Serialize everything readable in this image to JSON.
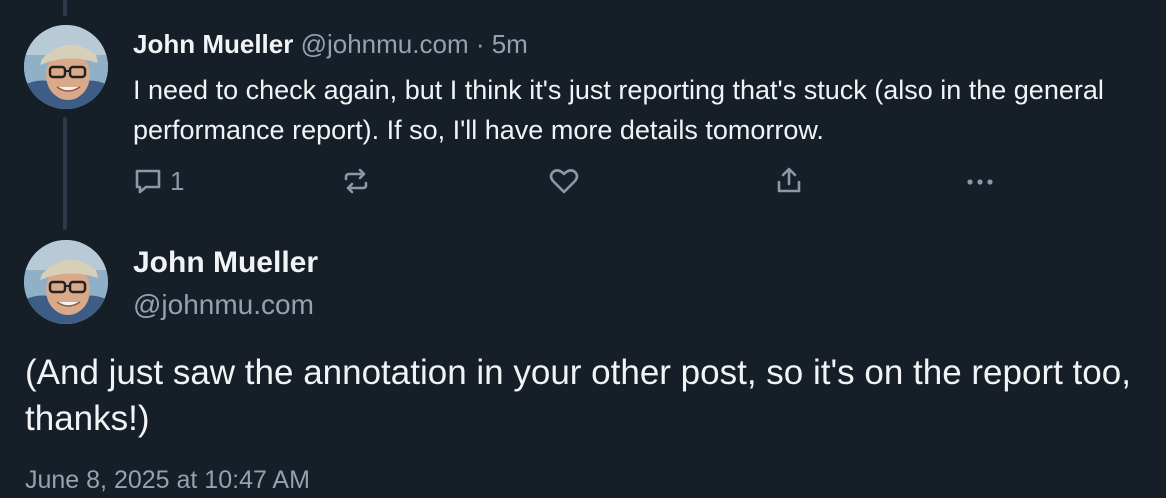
{
  "reply": {
    "author_name": "John Mueller",
    "author_handle": "@johnmu.com",
    "separator": " · ",
    "time_ago": "5m",
    "text": "I need to check again, but I think it's just reporting that's stuck (also in the general performance report). If so, I'll have more details tomorrow.",
    "actions": {
      "reply_icon": "speech-bubble-icon",
      "reply_count": "1",
      "repost_icon": "repost-arrows-icon",
      "like_icon": "heart-icon",
      "share_icon": "share-upload-icon",
      "more_icon": "ellipsis-icon"
    }
  },
  "post": {
    "author_name": "John Mueller",
    "author_handle": "@johnmu.com",
    "text": "(And just saw the annotation in your other post, so it's on the report too, thanks!)",
    "timestamp": "June 8, 2025 at 10:47 AM"
  },
  "colors": {
    "background": "#161e27",
    "text_primary": "#f1f3f5",
    "text_muted": "#93a1b1",
    "thread_line": "#2e3a48"
  }
}
